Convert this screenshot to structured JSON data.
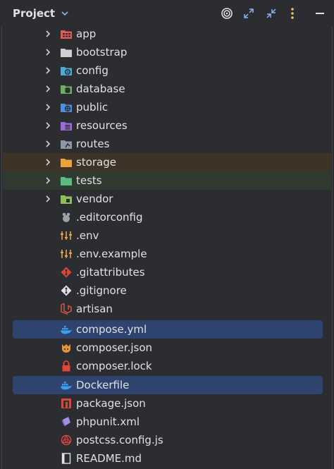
{
  "header": {
    "title": "Project"
  },
  "rows": [
    {
      "label": "app"
    },
    {
      "label": "bootstrap"
    },
    {
      "label": "config"
    },
    {
      "label": "database"
    },
    {
      "label": "public"
    },
    {
      "label": "resources"
    },
    {
      "label": "routes"
    },
    {
      "label": "storage"
    },
    {
      "label": "tests"
    },
    {
      "label": "vendor"
    },
    {
      "label": ".editorconfig"
    },
    {
      "label": ".env"
    },
    {
      "label": ".env.example"
    },
    {
      "label": ".gitattributes"
    },
    {
      "label": ".gitignore"
    },
    {
      "label": "artisan"
    },
    {
      "label": "compose.yml"
    },
    {
      "label": "composer.json"
    },
    {
      "label": "composer.lock"
    },
    {
      "label": "Dockerfile"
    },
    {
      "label": "package.json"
    },
    {
      "label": "phpunit.xml"
    },
    {
      "label": "postcss.config.js"
    },
    {
      "label": "README.md"
    }
  ],
  "colors": {
    "background": "#2b2d30",
    "selection": "#2e436e",
    "storage_highlight": "#3d3326",
    "tests_highlight": "#2f3b30"
  }
}
